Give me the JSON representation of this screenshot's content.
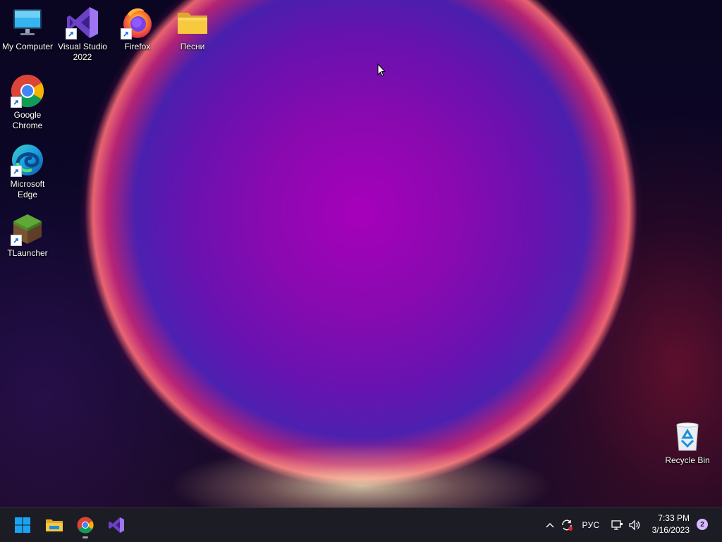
{
  "desktop": {
    "icons": [
      {
        "label": "My Computer",
        "icon": "monitor-icon",
        "shortcut": false
      },
      {
        "label": "Visual Studio 2022",
        "icon": "visual-studio-icon",
        "shortcut": true
      },
      {
        "label": "Firefox",
        "icon": "firefox-icon",
        "shortcut": true
      },
      {
        "label": "Песни",
        "icon": "folder-icon",
        "shortcut": false
      },
      {
        "label": "Google Chrome",
        "icon": "chrome-icon",
        "shortcut": true
      },
      {
        "label": "Microsoft Edge",
        "icon": "edge-icon",
        "shortcut": true
      },
      {
        "label": "TLauncher",
        "icon": "tlauncher-grass-block-icon",
        "shortcut": true
      },
      {
        "label": "Recycle Bin",
        "icon": "recycle-bin-icon",
        "shortcut": false
      }
    ]
  },
  "taskbar": {
    "pinned": [
      {
        "name": "Start",
        "icon": "windows-start-icon"
      },
      {
        "name": "File Explorer",
        "icon": "file-explorer-icon"
      },
      {
        "name": "Google Chrome",
        "icon": "chrome-icon",
        "running": true
      },
      {
        "name": "Visual Studio 2022",
        "icon": "visual-studio-icon"
      }
    ],
    "tray": {
      "language": "РУС",
      "time": "7:33 PM",
      "date": "3/16/2023",
      "notifications_count": "2"
    }
  },
  "colors": {
    "taskbar_bg": "#1c1c24",
    "accent_purple": "#8a5cd6",
    "windows_blue": "#1aa3f0",
    "folder_yellow": "#f8c93f"
  }
}
